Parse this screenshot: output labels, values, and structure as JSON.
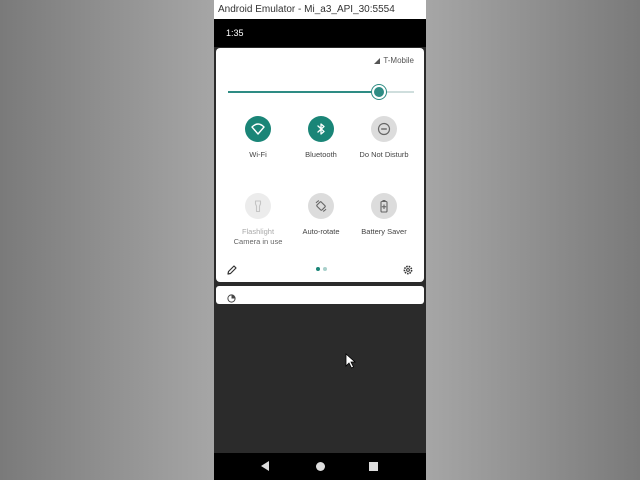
{
  "window": {
    "title": "Android Emulator - Mi_a3_API_30:5554"
  },
  "status_bar": {
    "time": "1:35"
  },
  "quick_settings": {
    "carrier": "T-Mobile",
    "brightness_level": 0.81,
    "tiles": [
      {
        "label": "Wi-Fi",
        "sub": "",
        "icon": "wifi-icon",
        "state": "on"
      },
      {
        "label": "Bluetooth",
        "sub": "",
        "icon": "bluetooth-icon",
        "state": "on"
      },
      {
        "label": "Do Not Disturb",
        "sub": "",
        "icon": "do-not-disturb-icon",
        "state": "off"
      },
      {
        "label": "Flashlight",
        "sub": "Camera in use",
        "icon": "flashlight-icon",
        "state": "unavailable"
      },
      {
        "label": "Auto-rotate",
        "sub": "",
        "icon": "auto-rotate-icon",
        "state": "off"
      },
      {
        "label": "Battery Saver",
        "sub": "",
        "icon": "battery-saver-icon",
        "state": "off"
      }
    ],
    "page_indicator": {
      "pages": 2,
      "current": 1
    }
  },
  "colors": {
    "accent": "#1a8577",
    "tile_off": "#dcdcdc",
    "panel": "#ffffff",
    "shade": "#2b2b2b"
  },
  "navigation": {
    "buttons": [
      "back-icon",
      "home-icon",
      "recents-icon"
    ]
  }
}
